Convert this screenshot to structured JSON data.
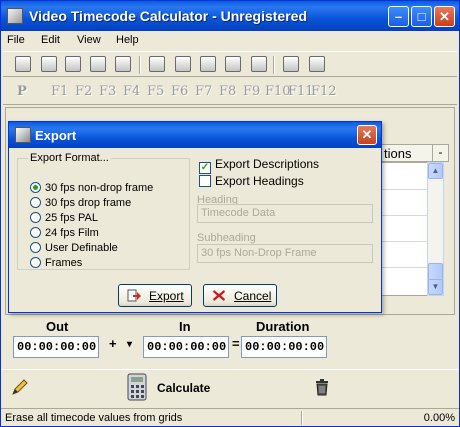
{
  "window": {
    "title": "Video Timecode Calculator - Unregistered"
  },
  "menu": [
    "File",
    "Edit",
    "View",
    "Help"
  ],
  "toolbar": {
    "p_label": "P",
    "fkeys": [
      "F1",
      "F2",
      "F3",
      "F4",
      "F5",
      "F6",
      "F7",
      "F8",
      "F9",
      "F10",
      "F11",
      "F12"
    ]
  },
  "grid": {
    "header": "tions",
    "collapse": "-"
  },
  "dialog": {
    "title": "Export",
    "format_group": "Export Format...",
    "formats": [
      "30 fps non-drop frame",
      "30 fps drop frame",
      "25 fps PAL",
      "24 fps Film",
      "User Definable",
      "Frames"
    ],
    "selected_format": "30 fps non-drop frame",
    "export_descriptions": {
      "label": "Export Descriptions",
      "checked": true
    },
    "export_headings": {
      "label": "Export Headings",
      "checked": false
    },
    "heading_label": "Heading",
    "heading_value": "Timecode Data",
    "subheading_label": "Subheading",
    "subheading_value": "30 fps Non-Drop Frame",
    "export_button": "Export",
    "cancel_button": "Cancel"
  },
  "calc": {
    "out_label": "Out",
    "in_label": "In",
    "duration_label": "Duration",
    "out_value": "00:00:00:00",
    "in_value": "00:00:00:00",
    "duration_value": "00:00:00:00",
    "operator": "+",
    "operator_dropdown": "▾",
    "equals": "=",
    "calculate_button": "Calculate"
  },
  "status": {
    "message": "Erase all timecode values from grids",
    "percent": "0.00%"
  }
}
